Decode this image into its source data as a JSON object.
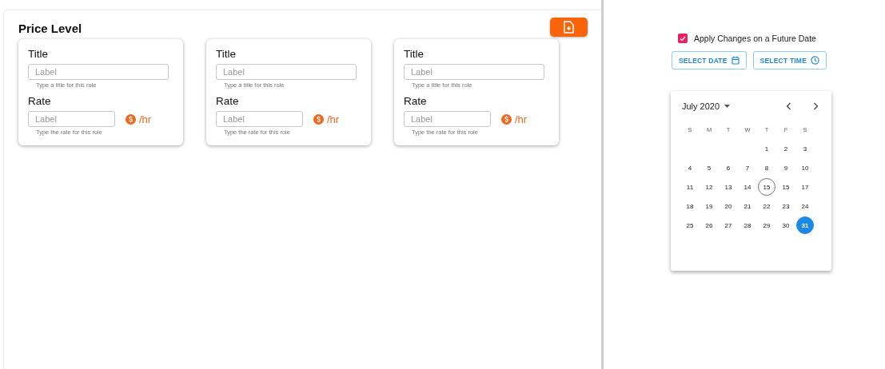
{
  "panel": {
    "title": "Price Level"
  },
  "cards": [
    {
      "title_label": "Title",
      "title_placeholder": "Label",
      "title_hint": "Type a title for this role",
      "rate_label": "Rate",
      "rate_placeholder": "Label",
      "rate_hint": "Type the rate for this role",
      "unit": "/hr"
    },
    {
      "title_label": "Title",
      "title_placeholder": "Label",
      "title_hint": "Type a title for this role",
      "rate_label": "Rate",
      "rate_placeholder": "Label",
      "rate_hint": "Type the rate for this role",
      "unit": "/hr"
    },
    {
      "title_label": "Title",
      "title_placeholder": "Label",
      "title_hint": "Type a title for this role",
      "rate_label": "Rate",
      "rate_placeholder": "Label",
      "rate_hint": "Type the rate for this role",
      "unit": "/hr"
    }
  ],
  "future_date": {
    "label": "Apply Changes on a Future Date",
    "checked": true
  },
  "buttons": [
    {
      "label": "SELECT DATE",
      "kind": "date"
    },
    {
      "label": "SELECT TIME",
      "kind": "time"
    }
  ],
  "calendar": {
    "month": "July 2020",
    "weekdays": [
      "S",
      "M",
      "T",
      "W",
      "T",
      "F",
      "S"
    ],
    "days": [
      {
        "day": "1",
        "today": false,
        "selected": false
      },
      {
        "day": "2",
        "today": false,
        "selected": false
      },
      {
        "day": "3",
        "today": false,
        "selected": false
      },
      {
        "day": "4",
        "today": false,
        "selected": false
      },
      {
        "day": "5",
        "today": false,
        "selected": false
      },
      {
        "day": "6",
        "today": false,
        "selected": false
      },
      {
        "day": "7",
        "today": false,
        "selected": false
      },
      {
        "day": "8",
        "today": false,
        "selected": false
      },
      {
        "day": "9",
        "today": false,
        "selected": false
      },
      {
        "day": "10",
        "today": false,
        "selected": false
      },
      {
        "day": "11",
        "today": false,
        "selected": false
      },
      {
        "day": "12",
        "today": false,
        "selected": false
      },
      {
        "day": "13",
        "today": false,
        "selected": false
      },
      {
        "day": "14",
        "today": false,
        "selected": false
      },
      {
        "day": "15",
        "today": true,
        "selected": false
      },
      {
        "day": "15",
        "today": false,
        "selected": false
      },
      {
        "day": "17",
        "today": false,
        "selected": false
      },
      {
        "day": "18",
        "today": false,
        "selected": false
      },
      {
        "day": "19",
        "today": false,
        "selected": false
      },
      {
        "day": "20",
        "today": false,
        "selected": false
      },
      {
        "day": "21",
        "today": false,
        "selected": false
      },
      {
        "day": "22",
        "today": false,
        "selected": false
      },
      {
        "day": "23",
        "today": false,
        "selected": false
      },
      {
        "day": "24",
        "today": false,
        "selected": false
      },
      {
        "day": "25",
        "today": false,
        "selected": false
      },
      {
        "day": "26",
        "today": false,
        "selected": false
      },
      {
        "day": "27",
        "today": false,
        "selected": false
      },
      {
        "day": "28",
        "today": false,
        "selected": false
      },
      {
        "day": "29",
        "today": false,
        "selected": false
      },
      {
        "day": "30",
        "today": false,
        "selected": false
      },
      {
        "day": "31",
        "today": false,
        "selected": true
      }
    ]
  }
}
